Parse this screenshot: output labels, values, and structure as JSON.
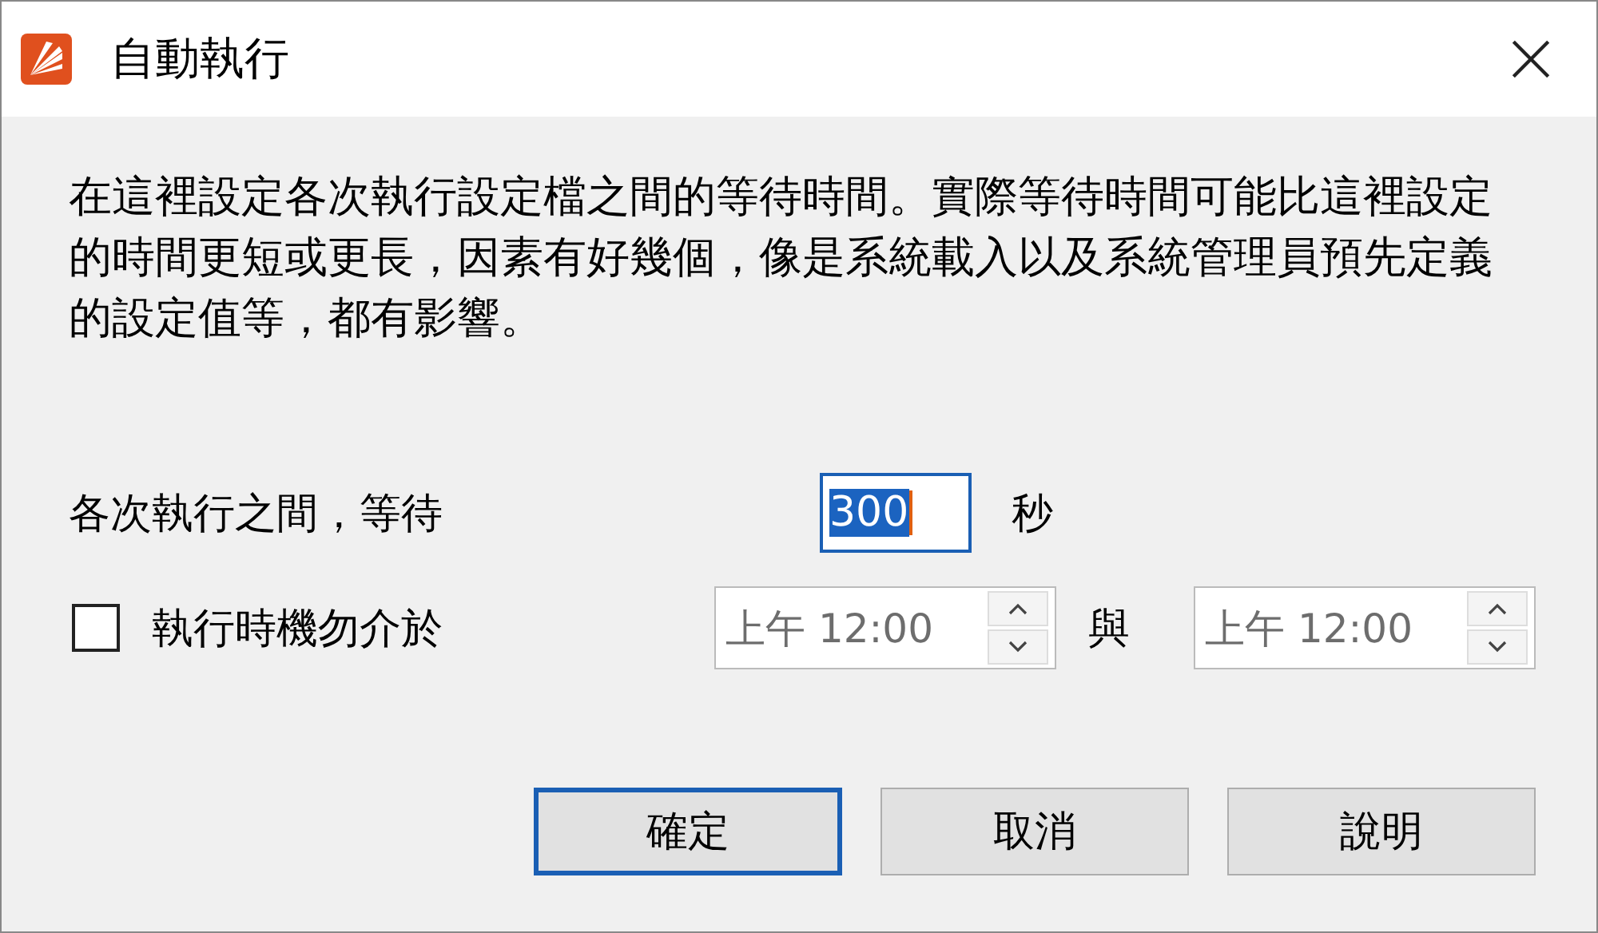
{
  "window": {
    "title": "自動執行"
  },
  "description": "在這裡設定各次執行設定檔之間的等待時間。實際等待時間可能比這裡設定的時間更短或更長，因素有好幾個，像是系統載入以及系統管理員預先定義的設定值等，都有影響。",
  "interval": {
    "label": "各次執行之間，等待",
    "value": "300",
    "selected": true,
    "unit": "秒"
  },
  "exclude": {
    "label": "執行時機勿介於",
    "checked": false,
    "start": {
      "value": "上午 12:00",
      "disabled": true
    },
    "joiner": "與",
    "end": {
      "value": "上午 12:00",
      "disabled": true
    }
  },
  "buttons": [
    {
      "label": "確定",
      "default": true
    },
    {
      "label": "取消",
      "default": false
    },
    {
      "label": "說明",
      "default": false
    }
  ]
}
